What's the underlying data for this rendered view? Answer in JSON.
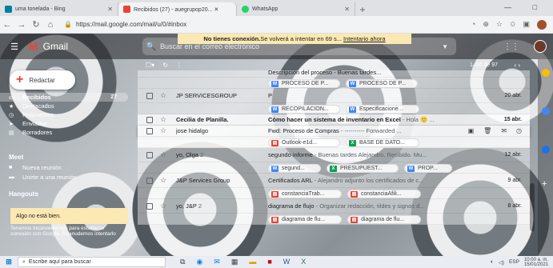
{
  "browser": {
    "tabs": [
      {
        "title": "uma tonelada - Bing",
        "color": "#00809d"
      },
      {
        "title": "Recibidos (27) - auegrupop20... ✕",
        "color": "#ea4335"
      },
      {
        "title": "WhatsApp",
        "color": "#25d366"
      }
    ],
    "new_tab": "+",
    "window_controls": "— □",
    "url": "https://mail.google.com/mail/u/0/#inbox"
  },
  "offline_banner": {
    "bold": "No tienes conexión.",
    "text": " Se volverá a intentar en 69 s...",
    "retry": "Intentario ahora"
  },
  "header": {
    "logo_text": "Gmail",
    "search_placeholder": "Buscar en el correo electrónico"
  },
  "sidebar": {
    "compose": "Redactar",
    "items": [
      {
        "label": "Recibidos",
        "count": "27",
        "icon": "inbox-icon"
      },
      {
        "label": "Destacados",
        "icon": "star-icon"
      },
      {
        "label": "Pospuestos",
        "icon": "clock-icon"
      },
      {
        "label": "Enviados",
        "icon": "send-icon"
      },
      {
        "label": "Borradores",
        "icon": "draft-icon"
      }
    ],
    "meet_title": "Meet",
    "meet_items": [
      "Nueva reunión",
      "Unirte a una reunión"
    ],
    "hangouts_title": "Hangouts",
    "hangouts_alert": "Algo no está bien.",
    "hangouts_msg": "Tenemos inconvenientes para establecer conexión con Google. Reanudemos intentarlo"
  },
  "toolbar": {
    "pages": "1–50 de 97"
  },
  "emails": [
    {
      "sender": "",
      "subject": "Descripción del proceso - Buenas tardes...",
      "snippet": "",
      "date": "",
      "partial": true,
      "chips": [
        {
          "type": "word",
          "label": "PROCESO DE P..."
        },
        {
          "type": "word",
          "label": "PROCESO DE P..."
        }
      ]
    },
    {
      "sender": "JP SERVICESGROUP",
      "subject": "P",
      "snippet": "",
      "date": "20 abr.",
      "chips": [
        {
          "type": "word",
          "label": "RECOPILACION..."
        },
        {
          "type": "word",
          "label": "Especificacione..."
        }
      ]
    },
    {
      "sender": "Cecilia de Planilla.",
      "subject": "Cómo hacer un sistema de inventario en Excel",
      "snippet": " - Hola 🙂 ...",
      "date": "15 abr.",
      "unread": true
    },
    {
      "sender": "jose hidalgo",
      "subject": "Fwd: Proceso de Compras",
      "snippet": " - ---------- Forwarded ...",
      "date": "",
      "hover": true,
      "chips": [
        {
          "type": "pdf",
          "label": "Outlook-e1d..."
        },
        {
          "type": "xls",
          "label": "BASE DE DATO..."
        }
      ]
    },
    {
      "sender": "yo, Olga",
      "count": "2",
      "subject": "segundo informe",
      "snippet": " - Buenas tardes Alejandro, Recibido. Mu...",
      "date": "12 abr.",
      "chips": [
        {
          "type": "word",
          "label": "segund..."
        },
        {
          "type": "xls",
          "label": "PRESUPUEST..."
        },
        {
          "type": "word",
          "label": "PROP..."
        }
      ]
    },
    {
      "sender": "J&P Services Group",
      "subject": "Certificados ARL",
      "snippet": " - Alejandro adjunto los certificados de c...",
      "date": "9 abr.",
      "chips": [
        {
          "type": "pdf",
          "label": "constanciaTrab..."
        },
        {
          "type": "pdf",
          "label": "constanciaAfili..."
        }
      ]
    },
    {
      "sender": "yo, J&P",
      "count": "2",
      "subject": "diagrama de flujo",
      "snippet": " - Organizar redacción, tildes y signos d...",
      "date": "8 abr.",
      "chips": [
        {
          "type": "pdf",
          "label": "diagrama de flu..."
        },
        {
          "type": "pdf",
          "label": "diagrama de flu..."
        }
      ]
    }
  ],
  "taskbar": {
    "search_placeholder": "Escribe aquí para buscar",
    "tray_lang": "ESP",
    "time": "10:00 a. m.",
    "date": "15/01/2021"
  }
}
